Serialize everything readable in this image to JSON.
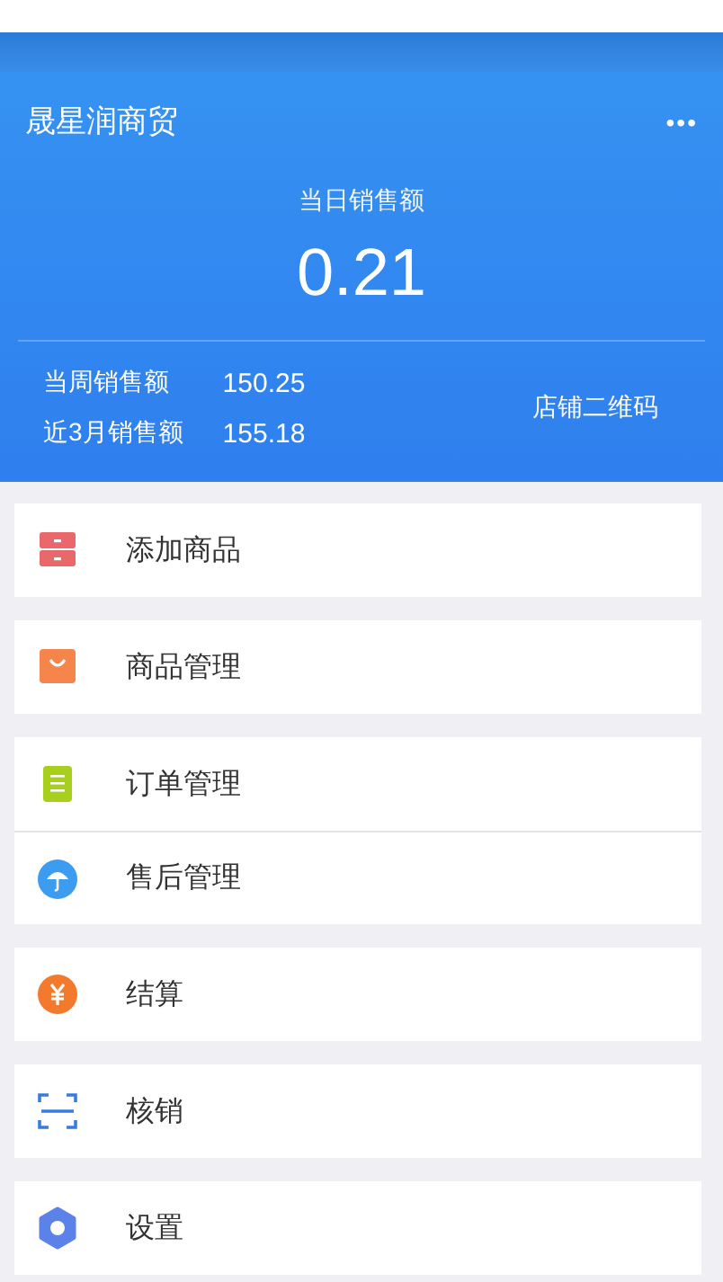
{
  "header": {
    "title": "晟星润商贸",
    "menu": "•••",
    "today_label": "当日销售额",
    "today_value": "0.21",
    "stats": [
      {
        "label": "当周销售额",
        "value": "150.25"
      },
      {
        "label": "近3月销售额",
        "value": "155.18"
      }
    ],
    "qr_link": "店铺二维码"
  },
  "menu_groups": [
    [
      {
        "kind": "drawer",
        "label": "添加商品"
      }
    ],
    [
      {
        "kind": "bag",
        "label": "商品管理"
      }
    ],
    [
      {
        "kind": "clipboard",
        "label": "订单管理"
      },
      {
        "kind": "umbrella",
        "label": "售后管理"
      }
    ],
    [
      {
        "kind": "yen",
        "label": "结算"
      }
    ],
    [
      {
        "kind": "scan",
        "label": "核销"
      }
    ],
    [
      {
        "kind": "gear",
        "label": "设置"
      }
    ]
  ]
}
